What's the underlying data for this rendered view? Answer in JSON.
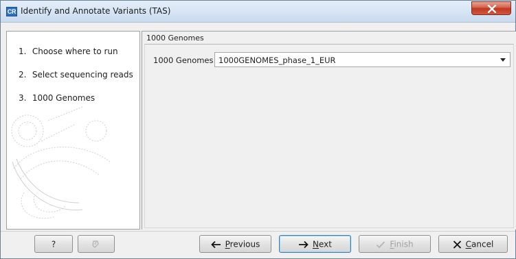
{
  "window": {
    "app_icon": "CR",
    "title": "Identify and Annotate Variants (TAS)"
  },
  "steps": [
    {
      "num": "1.",
      "label": "Choose where to run"
    },
    {
      "num": "2.",
      "label": "Select sequencing reads"
    },
    {
      "num": "3.",
      "label": "1000 Genomes"
    }
  ],
  "content": {
    "group_title": "1000 Genomes",
    "field_label": "1000 Genomes",
    "select_value": "1000GENOMES_phase_1_EUR"
  },
  "buttons": {
    "help": "?",
    "previous_first": "P",
    "previous_rest": "revious",
    "next_first": "N",
    "next_rest": "ext",
    "finish_first": "F",
    "finish_rest": "inish",
    "cancel_first": "C",
    "cancel_rest": "ancel"
  },
  "icons": {
    "close": "close-icon",
    "reset": "reset-icon",
    "previous": "arrow-left-icon",
    "next": "arrow-right-icon",
    "finish": "check-icon",
    "cancel": "x-icon"
  },
  "colors": {
    "accent": "#2b71c2",
    "close": "#c2371f",
    "primary_border": "#3c7fb1"
  }
}
